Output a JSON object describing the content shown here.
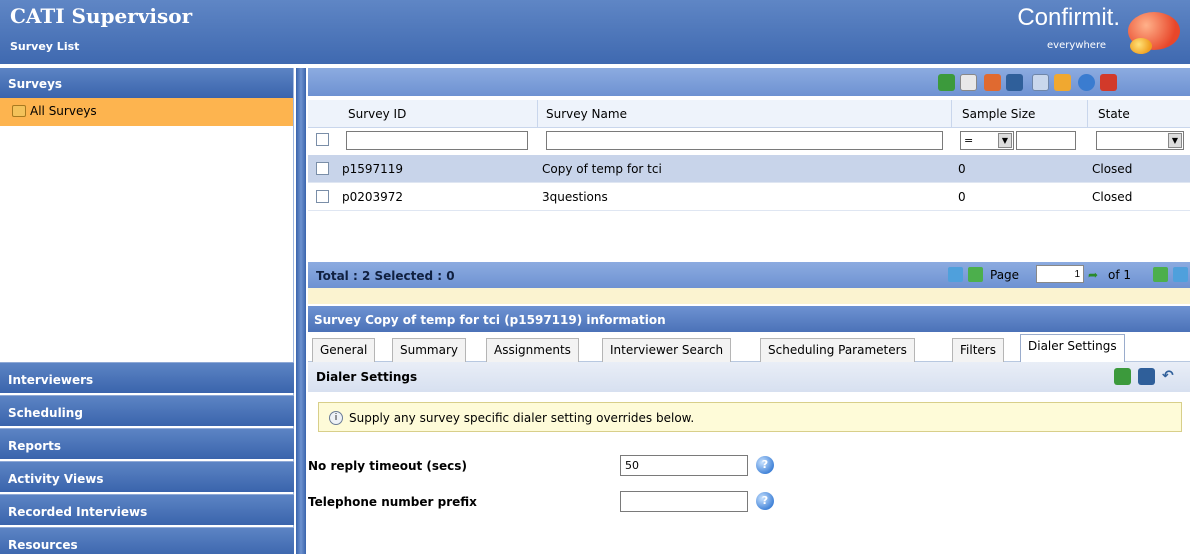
{
  "header": {
    "title": "CATI Supervisor",
    "subtitle": "Survey List",
    "logo": "Confirmit.",
    "logo_tagline": "everywhere"
  },
  "sidebar": {
    "section": "Surveys",
    "tree_item": "All Surveys",
    "nav": [
      "Interviewers",
      "Scheduling",
      "Reports",
      "Activity Views",
      "Recorded Interviews",
      "Resources"
    ]
  },
  "toolbar": {
    "icons": [
      "refresh-icon",
      "clear-icon",
      "open-survey-icon",
      "properties-icon",
      "attach-icon",
      "export-icon",
      "help-icon",
      "close-icon"
    ]
  },
  "grid": {
    "columns": [
      "Survey ID",
      "Survey Name",
      "Sample Size",
      "State"
    ],
    "filter": {
      "survey_id": "",
      "survey_name": "",
      "sample_op": "=",
      "sample_value": "",
      "state": ""
    },
    "rows": [
      {
        "id": "p1597119",
        "name": "Copy of temp for tci",
        "sample": "0",
        "state": "Closed",
        "selected": true
      },
      {
        "id": "p0203972",
        "name": "3questions",
        "sample": "0",
        "state": "Closed",
        "selected": false
      }
    ],
    "footer": {
      "total": "Total : 2 Selected : 0",
      "page_label": "Page",
      "page_value": "1",
      "of_label": "of 1"
    }
  },
  "info": {
    "title": "Survey Copy of temp for tci (p1597119) information",
    "tabs": [
      "General",
      "Summary",
      "Assignments",
      "Interviewer Search",
      "Scheduling Parameters",
      "Filters",
      "Dialer Settings"
    ],
    "active_tab": "Dialer Settings"
  },
  "dialer": {
    "heading": "Dialer Settings",
    "notice": "Supply any survey specific dialer setting overrides below.",
    "no_reply_label": "No reply timeout (secs)",
    "no_reply_value": "50",
    "prefix_label": "Telephone number prefix",
    "prefix_value": ""
  },
  "colors": {
    "header_blue": "#4a73b8",
    "selected_orange": "#fdb44f",
    "notice_bg": "#fefbd8"
  }
}
